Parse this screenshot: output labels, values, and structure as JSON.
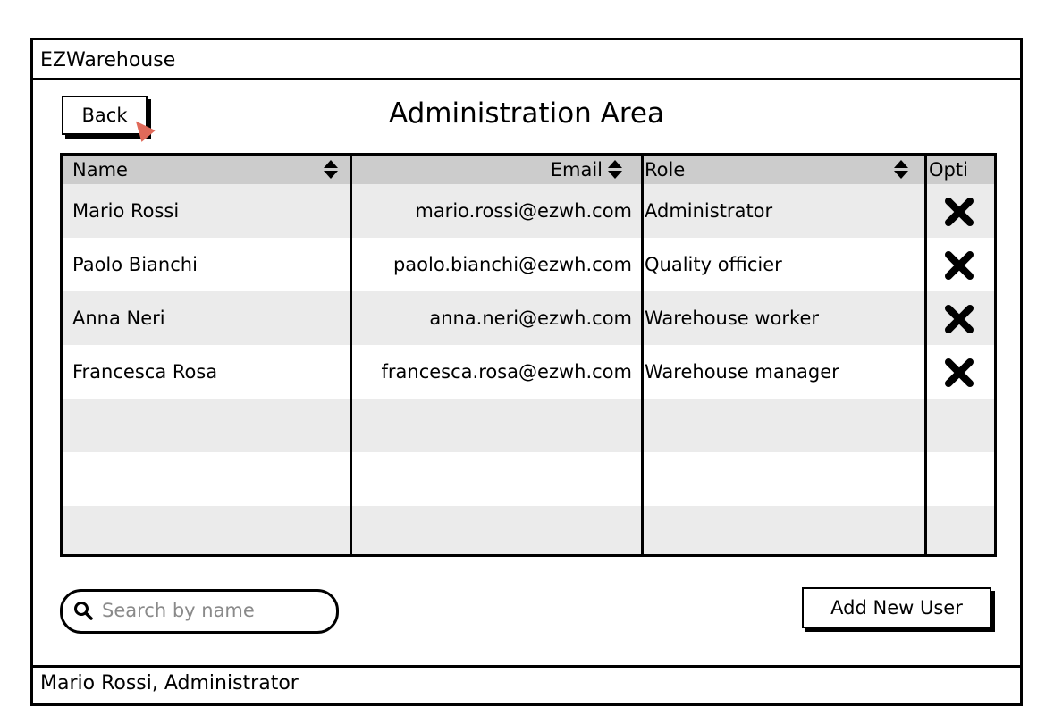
{
  "app": {
    "title": "EZWarehouse"
  },
  "header": {
    "back_label": "Back",
    "page_title": "Administration Area"
  },
  "table": {
    "columns": [
      "Name",
      "Email",
      "Role",
      "Opti"
    ],
    "rows": [
      {
        "name": "Mario Rossi",
        "email": "mario.rossi@ezwh.com",
        "role": "Administrator",
        "option_icon": "close-icon"
      },
      {
        "name": "Paolo Bianchi",
        "email": "paolo.bianchi@ezwh.com",
        "role": "Quality officier",
        "option_icon": "close-icon"
      },
      {
        "name": "Anna Neri",
        "email": "anna.neri@ezwh.com",
        "role": "Warehouse worker",
        "option_icon": "close-icon"
      },
      {
        "name": "Francesca Rosa",
        "email": "francesca.rosa@ezwh.com",
        "role": "Warehouse manager",
        "option_icon": "close-icon"
      }
    ]
  },
  "search": {
    "placeholder": "Search by name",
    "value": ""
  },
  "actions": {
    "add_user_label": "Add New User"
  },
  "status": {
    "text": "Mario Rossi, Administrator"
  },
  "colors": {
    "header_bg": "#cccccc",
    "stripe_bg": "#ebebeb",
    "cursor_accent": "#e06a5a"
  }
}
